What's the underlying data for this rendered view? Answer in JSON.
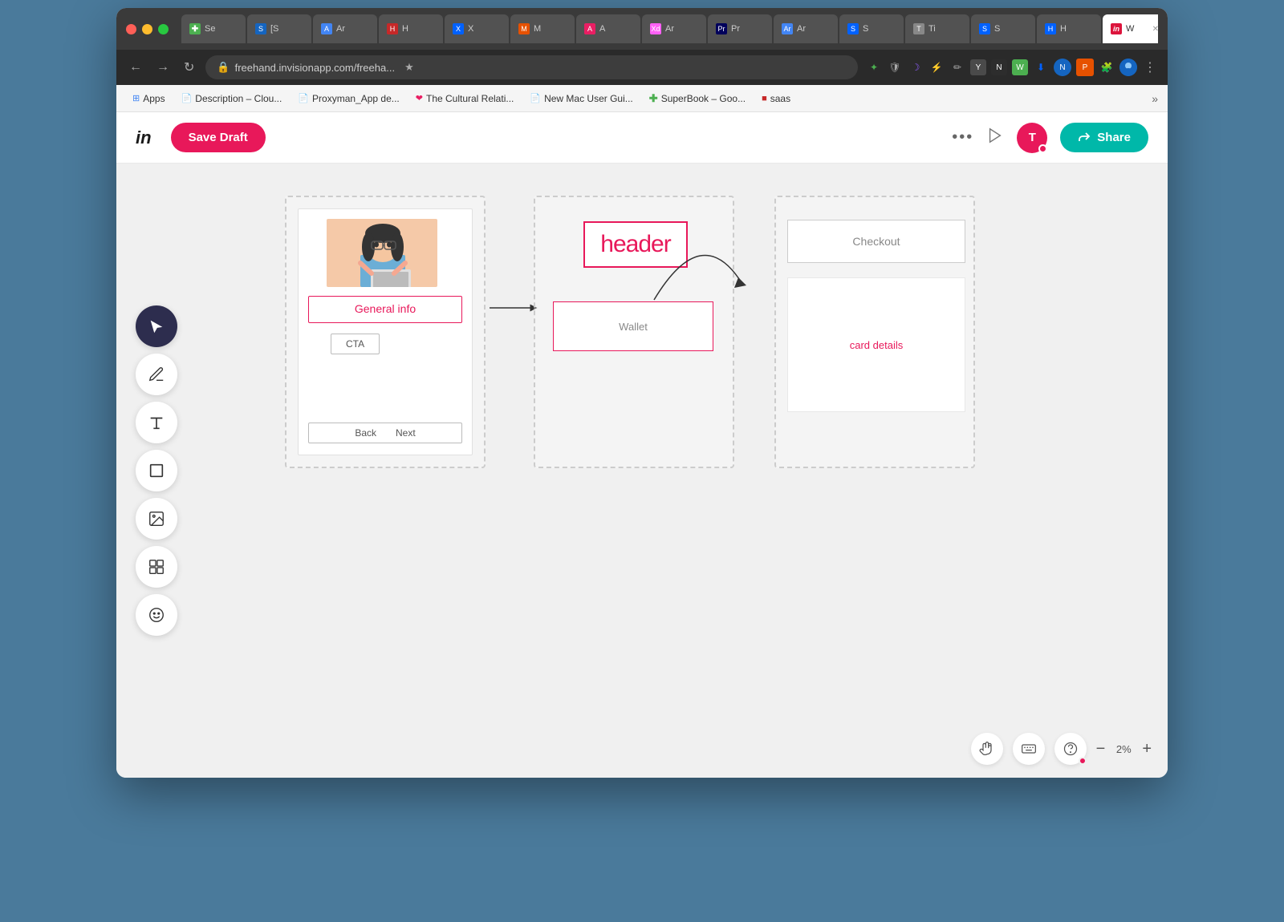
{
  "browser": {
    "tabs": [
      {
        "id": "t1",
        "label": "Se",
        "favicon_color": "#4caf50",
        "active": false
      },
      {
        "id": "t2",
        "label": "S",
        "favicon_color": "#1565c0",
        "active": false
      },
      {
        "id": "t3",
        "label": "Ar",
        "favicon_color": "#4285f4",
        "active": false
      },
      {
        "id": "t4",
        "label": "H",
        "favicon_color": "#c62828",
        "active": false
      },
      {
        "id": "t5",
        "label": "X",
        "favicon_color": "#0061ff",
        "active": false
      },
      {
        "id": "t6",
        "label": "M",
        "favicon_color": "#e65100",
        "active": false
      },
      {
        "id": "t7",
        "label": "A",
        "favicon_color": "#e91e63",
        "active": false
      },
      {
        "id": "t8",
        "label": "Ar",
        "favicon_color": "#ff61f6",
        "active": false
      },
      {
        "id": "t9",
        "label": "Pr",
        "favicon_color": "#00005b",
        "active": false
      },
      {
        "id": "t10",
        "label": "Ar",
        "favicon_color": "#4285f4",
        "active": false
      },
      {
        "id": "t11",
        "label": "S",
        "favicon_color": "#0061ff",
        "active": false
      },
      {
        "id": "t12",
        "label": "Ti",
        "favicon_color": "#888",
        "active": false
      },
      {
        "id": "t13",
        "label": "S",
        "favicon_color": "#0061ff",
        "active": false
      },
      {
        "id": "t14",
        "label": "H",
        "favicon_color": "#0061ff",
        "active": false
      },
      {
        "id": "t15",
        "label": "W",
        "favicon_color": "#dc143c",
        "active": true
      }
    ],
    "address": "freehand.invisionapp.com/freeha...",
    "nav_back": "←",
    "nav_forward": "→",
    "nav_refresh": "↻",
    "lock_icon": "🔒"
  },
  "bookmarks": [
    {
      "label": "Apps",
      "icon": "⊞",
      "color": "#4285f4"
    },
    {
      "label": "Description – Clou...",
      "icon": "📄",
      "color": "#4285f4"
    },
    {
      "label": "Proxyman_App de...",
      "icon": "📄",
      "color": "#4285f4"
    },
    {
      "label": "The Cultural Relati...",
      "icon": "❤",
      "color": "#e91e63"
    },
    {
      "label": "New Mac User Gui...",
      "icon": "📄",
      "color": "#4285f4"
    },
    {
      "label": "SuperBook – Goo...",
      "icon": "✚",
      "color": "#4caf50"
    },
    {
      "label": "saas",
      "icon": "■",
      "color": "#c62828"
    }
  ],
  "header": {
    "logo": "in",
    "save_draft_label": "Save Draft",
    "more_label": "•••",
    "play_label": "▷",
    "avatar_label": "T",
    "share_label": "Share",
    "share_icon": "↗"
  },
  "canvas": {
    "frame1": {
      "character_alt": "character illustration",
      "general_info": "General info",
      "cta": "CTA",
      "back": "Back",
      "next": "Next"
    },
    "frame2": {
      "header_text": "header",
      "wallet": "Wallet"
    },
    "frame3": {
      "checkout": "Checkout",
      "card_details": "card details"
    }
  },
  "bottom_toolbar": {
    "hand_icon": "✋",
    "keyboard_icon": "⌨",
    "help_icon": "?",
    "zoom_minus": "−",
    "zoom_level": "2%",
    "zoom_plus": "+"
  },
  "left_toolbar": {
    "tools": [
      {
        "name": "cursor",
        "icon": "▶",
        "active": true
      },
      {
        "name": "pencil",
        "icon": "✏",
        "active": false
      },
      {
        "name": "text",
        "icon": "T",
        "active": false
      },
      {
        "name": "rectangle",
        "icon": "□",
        "active": false
      },
      {
        "name": "image",
        "icon": "🖼",
        "active": false
      },
      {
        "name": "component",
        "icon": "⊡",
        "active": false
      },
      {
        "name": "emoji",
        "icon": "☺",
        "active": false
      }
    ]
  }
}
